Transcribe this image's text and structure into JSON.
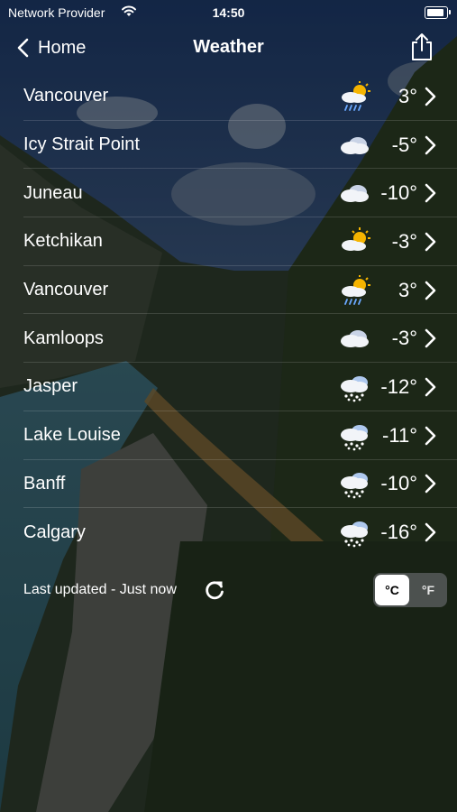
{
  "status_bar": {
    "carrier": "Network Provider",
    "time": "14:50",
    "battery_level": 1.0
  },
  "nav": {
    "back_label": "Home",
    "title": "Weather",
    "share_icon": "share-icon"
  },
  "cities": [
    {
      "name": "Vancouver",
      "icon": "partly-sunny-rain",
      "temp": "3°"
    },
    {
      "name": "Icy Strait Point",
      "icon": "cloudy",
      "temp": "-5°"
    },
    {
      "name": "Juneau",
      "icon": "cloudy",
      "temp": "-10°"
    },
    {
      "name": "Ketchikan",
      "icon": "partly-sunny",
      "temp": "-3°"
    },
    {
      "name": "Vancouver",
      "icon": "partly-sunny-rain",
      "temp": "3°"
    },
    {
      "name": "Kamloops",
      "icon": "cloudy",
      "temp": "-3°"
    },
    {
      "name": "Jasper",
      "icon": "snow",
      "temp": "-12°"
    },
    {
      "name": "Lake Louise",
      "icon": "snow",
      "temp": "-11°"
    },
    {
      "name": "Banff",
      "icon": "snow",
      "temp": "-10°"
    },
    {
      "name": "Calgary",
      "icon": "snow",
      "temp": "-16°"
    }
  ],
  "footer": {
    "last_updated": "Last updated - Just now",
    "unit_celsius": "°C",
    "unit_fahrenheit": "°F",
    "selected_unit": "°C"
  },
  "colors": {
    "sun": "#f5b400",
    "cloud": "#f2f4f8",
    "rain": "#6aa8ff"
  }
}
